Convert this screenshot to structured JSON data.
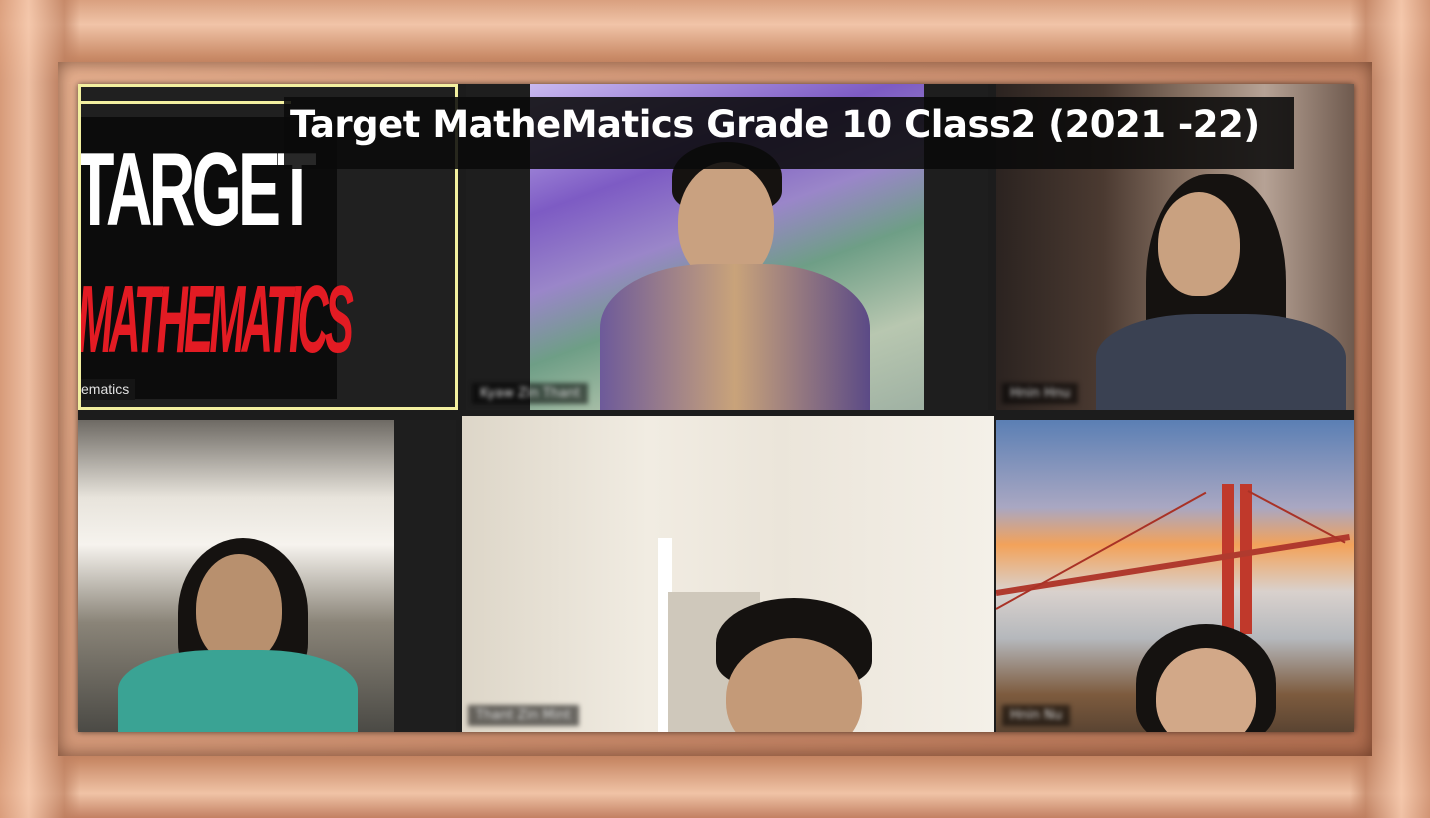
{
  "banner": {
    "title": "Target MatheMatics Grade 10 Class2 (2021 -22)"
  },
  "logo": {
    "line1": "TARGET",
    "line2": "MATHEMATICS",
    "caption": "ematics"
  },
  "participants": [
    {
      "tile": "presenter-logo",
      "name": "ematics",
      "active": true
    },
    {
      "tile": "participant-2",
      "name": "Kyaw Zin Thant"
    },
    {
      "tile": "participant-3",
      "name": "Hnin Hnu"
    },
    {
      "tile": "participant-4",
      "name": ""
    },
    {
      "tile": "participant-5",
      "name": "Thant Zin Mint",
      "speaking": true
    },
    {
      "tile": "participant-6",
      "name": "Hnin Nu"
    }
  ],
  "colors": {
    "speaking_border": "#7ed321",
    "pinned_border": "#f3f0a0",
    "logo_red": "#e31b23"
  }
}
